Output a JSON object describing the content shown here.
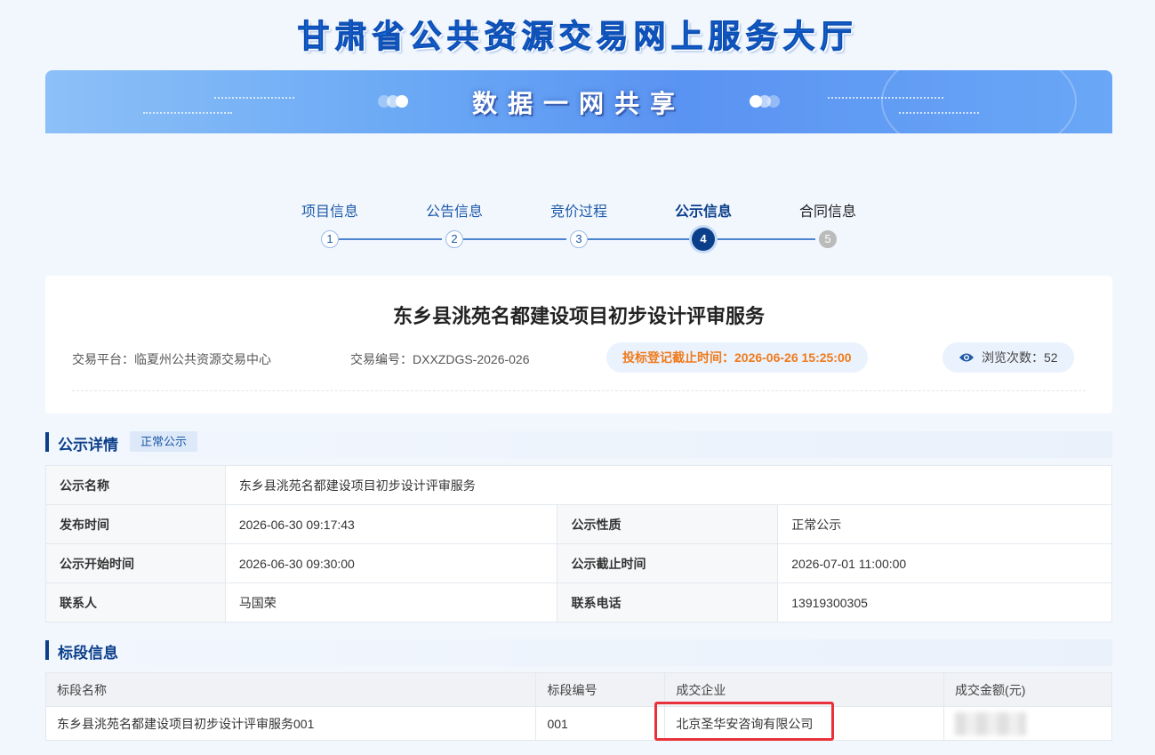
{
  "site": {
    "title": "甘肃省公共资源交易网上服务大厅",
    "slogan": "数据一网共享"
  },
  "steps": [
    {
      "label": "项目信息",
      "num": "1",
      "state": "done"
    },
    {
      "label": "公告信息",
      "num": "2",
      "state": "done"
    },
    {
      "label": "竞价过程",
      "num": "3",
      "state": "done"
    },
    {
      "label": "公示信息",
      "num": "4",
      "state": "active"
    },
    {
      "label": "合同信息",
      "num": "5",
      "state": "future"
    }
  ],
  "project": {
    "title": "东乡县洮苑名都建设项目初步设计评审服务",
    "platform": "交易平台：临夏州公共资源交易中心",
    "code": "交易编号：DXXZDGS-2026-026",
    "deadline": "投标登记截止时间：2026-06-26 15:25:00",
    "views_label": "浏览次数：",
    "views_count": "52"
  },
  "notice": {
    "section_title": "公示详情",
    "tag": "正常公示",
    "name_label": "公示名称",
    "name_value": "东乡县洮苑名都建设项目初步设计评审服务",
    "publish_label": "发布时间",
    "publish_value": "2026-06-30 09:17:43",
    "nature_label": "公示性质",
    "nature_value": "正常公示",
    "start_label": "公示开始时间",
    "start_value": "2026-06-30 09:30:00",
    "end_label": "公示截止时间",
    "end_value": "2026-07-01 11:00:00",
    "contact_label": "联系人",
    "contact_value": "马国荣",
    "phone_label": "联系电话",
    "phone_value": "13919300305"
  },
  "lots": {
    "section_title": "标段信息",
    "headers": [
      "标段名称",
      "标段编号",
      "成交企业",
      "成交金额(元)"
    ],
    "rows": [
      {
        "name": "东乡县洮苑名都建设项目初步设计评审服务001",
        "code": "001",
        "company": "北京圣华安咨询有限公司",
        "amount": ""
      }
    ]
  },
  "colors": {
    "primary": "#0b3f8a",
    "deadline": "#f07a1a",
    "highlight": "#e8313a"
  }
}
